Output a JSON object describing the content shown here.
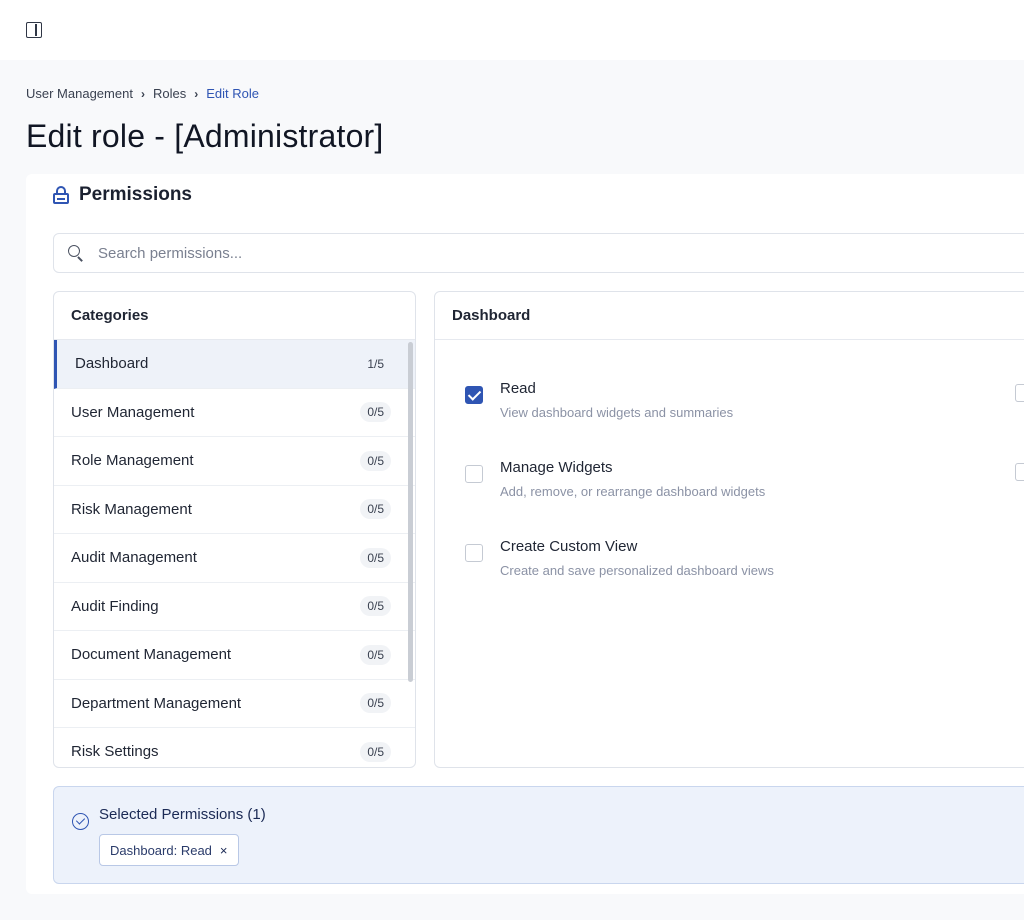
{
  "breadcrumb": {
    "items": [
      "User Management",
      "Roles"
    ],
    "current": "Edit Role",
    "separator": "›"
  },
  "page_title": "Edit role - [Administrator]",
  "permissions": {
    "title": "Permissions",
    "search_placeholder": "Search permissions..."
  },
  "categories": {
    "header": "Categories",
    "items": [
      {
        "label": "Dashboard",
        "count": "1/5",
        "active": true
      },
      {
        "label": "User Management",
        "count": "0/5"
      },
      {
        "label": "Role Management",
        "count": "0/5"
      },
      {
        "label": "Risk Management",
        "count": "0/5"
      },
      {
        "label": "Audit Management",
        "count": "0/5"
      },
      {
        "label": "Audit Finding",
        "count": "0/5"
      },
      {
        "label": "Document Management",
        "count": "0/5"
      },
      {
        "label": "Department Management",
        "count": "0/5"
      },
      {
        "label": "Risk Settings",
        "count": "0/5"
      }
    ]
  },
  "details": {
    "header": "Dashboard",
    "permissions": [
      {
        "name": "Read",
        "description": "View dashboard widgets and summaries",
        "checked": true
      },
      {
        "name": "Manage Widgets",
        "description": "Add, remove, or rearrange dashboard widgets",
        "checked": false
      },
      {
        "name": "Create Custom View",
        "description": "Create and save personalized dashboard views",
        "checked": false
      }
    ]
  },
  "selected": {
    "title": "Selected Permissions (1)",
    "chips": [
      {
        "label": "Dashboard: Read",
        "close": "×"
      }
    ]
  },
  "colors": {
    "accent": "#2f55b3",
    "active_bg": "#eef2f9",
    "selected_panel_bg": "#edf2fb"
  }
}
